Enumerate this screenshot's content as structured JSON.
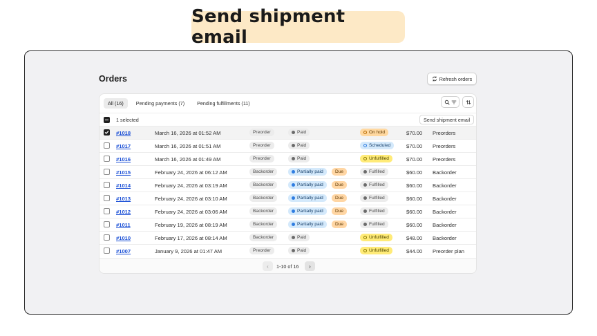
{
  "banner": {
    "title": "Send shipment email"
  },
  "page": {
    "title": "Orders",
    "refresh_label": "Refresh orders"
  },
  "tabs": [
    {
      "label": "All (16)",
      "active": true
    },
    {
      "label": "Pending payments (7)",
      "active": false
    },
    {
      "label": "Pending fulfillments (11)",
      "active": false
    }
  ],
  "toolbar": {
    "search_icon": "search-icon",
    "filter_icon": "filter-icon",
    "sort_icon": "sort-icon"
  },
  "bulk": {
    "selected_text": "1 selected",
    "action_label": "Send shipment email"
  },
  "orders": [
    {
      "id": "#1018",
      "date": "March 16, 2026 at 01:52 AM",
      "type": "Preorder",
      "payment": "Paid",
      "payment_kind": "paid",
      "due": "",
      "fulfillment": "On hold",
      "fulfillment_kind": "onhold",
      "total": "$70.00",
      "channel": "Preorders",
      "selected": true
    },
    {
      "id": "#1017",
      "date": "March 16, 2026 at 01:51 AM",
      "type": "Preorder",
      "payment": "Paid",
      "payment_kind": "paid",
      "due": "",
      "fulfillment": "Scheduled",
      "fulfillment_kind": "scheduled",
      "total": "$70.00",
      "channel": "Preorders",
      "selected": false
    },
    {
      "id": "#1016",
      "date": "March 16, 2026 at 01:49 AM",
      "type": "Preorder",
      "payment": "Paid",
      "payment_kind": "paid",
      "due": "",
      "fulfillment": "Unfulfilled",
      "fulfillment_kind": "unfulfilled",
      "total": "$70.00",
      "channel": "Preorders",
      "selected": false
    },
    {
      "id": "#1015",
      "date": "February 24, 2026 at 06:12 AM",
      "type": "Backorder",
      "payment": "Partially paid",
      "payment_kind": "partial",
      "due": "Due",
      "fulfillment": "Fulfilled",
      "fulfillment_kind": "fulfilled",
      "total": "$60.00",
      "channel": "Backorder",
      "selected": false
    },
    {
      "id": "#1014",
      "date": "February 24, 2026 at 03:19 AM",
      "type": "Backorder",
      "payment": "Partially paid",
      "payment_kind": "partial",
      "due": "Due",
      "fulfillment": "Fulfilled",
      "fulfillment_kind": "fulfilled",
      "total": "$60.00",
      "channel": "Backorder",
      "selected": false
    },
    {
      "id": "#1013",
      "date": "February 24, 2026 at 03:10 AM",
      "type": "Backorder",
      "payment": "Partially paid",
      "payment_kind": "partial",
      "due": "Due",
      "fulfillment": "Fulfilled",
      "fulfillment_kind": "fulfilled",
      "total": "$60.00",
      "channel": "Backorder",
      "selected": false
    },
    {
      "id": "#1012",
      "date": "February 24, 2026 at 03:06 AM",
      "type": "Backorder",
      "payment": "Partially paid",
      "payment_kind": "partial",
      "due": "Due",
      "fulfillment": "Fulfilled",
      "fulfillment_kind": "fulfilled",
      "total": "$60.00",
      "channel": "Backorder",
      "selected": false
    },
    {
      "id": "#1011",
      "date": "February 19, 2026 at 08:19 AM",
      "type": "Backorder",
      "payment": "Partially paid",
      "payment_kind": "partial",
      "due": "Due",
      "fulfillment": "Fulfilled",
      "fulfillment_kind": "fulfilled",
      "total": "$60.00",
      "channel": "Backorder",
      "selected": false
    },
    {
      "id": "#1010",
      "date": "February 17, 2026 at 08:14 AM",
      "type": "Backorder",
      "payment": "Paid",
      "payment_kind": "paid",
      "due": "",
      "fulfillment": "Unfulfilled",
      "fulfillment_kind": "unfulfilled",
      "total": "$48.00",
      "channel": "Backorder",
      "selected": false
    },
    {
      "id": "#1007",
      "date": "January 9, 2026 at 01:47 AM",
      "type": "Preorder",
      "payment": "Paid",
      "payment_kind": "paid",
      "due": "",
      "fulfillment": "Unfulfilled",
      "fulfillment_kind": "unfulfilled",
      "total": "$44.00",
      "channel": "Preorder plan",
      "selected": false
    }
  ],
  "pagination": {
    "label": "1-10 of 16",
    "prev_icon": "chevron-left-icon",
    "next_icon": "chevron-right-icon"
  },
  "colors": {
    "banner_bg": "#fde9c6",
    "link": "#1a4fd6",
    "on_hold": "#ffd8a0",
    "scheduled": "#d4e9fb",
    "unfulfilled": "#ffeb78",
    "partially_paid": "#d4e9fb",
    "due": "#ffd6a4"
  }
}
